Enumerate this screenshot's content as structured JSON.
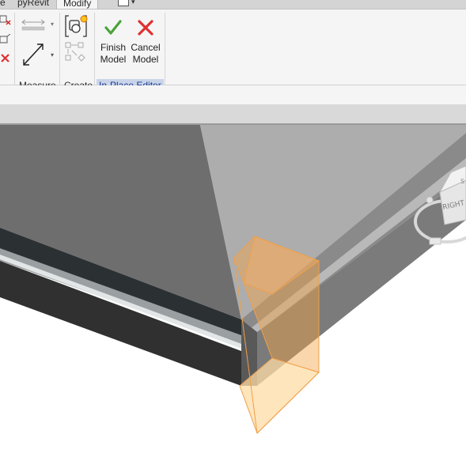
{
  "ribbon_tabs": {
    "partial_left": "e",
    "pyrevit": "pyRevit",
    "modify": "Modify"
  },
  "panels": {
    "measure": "Measure",
    "create": "Create",
    "in_place_editor": "In-Place Editor"
  },
  "buttons": {
    "finish_model_line1": "Finish",
    "finish_model_line2": "Model",
    "cancel_model_line1": "Cancel",
    "cancel_model_line2": "Model"
  },
  "viewcube": {
    "face_right": "RIGHT",
    "face_top_partial": "S"
  },
  "colors": {
    "accept": "#4aa339",
    "cancel": "#e03030",
    "selection_orange": "#f5a54a",
    "panel_highlight": "#c9d4ea"
  }
}
